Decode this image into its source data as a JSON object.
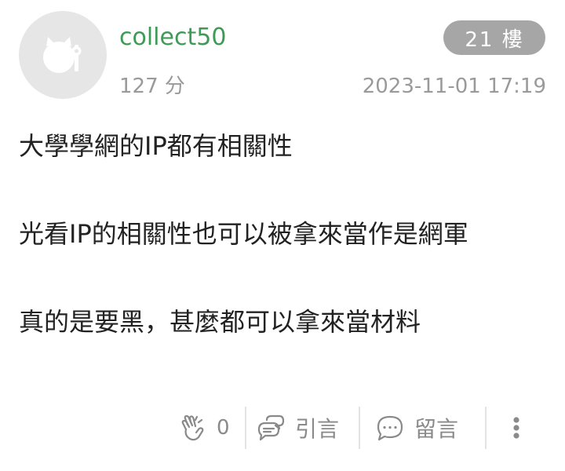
{
  "post": {
    "username": "collect50",
    "score": "127 分",
    "floor": "21 樓",
    "timestamp": "2023-11-01 17:19",
    "content": {
      "line1": "大學學網的IP都有相關性",
      "line2": "光看IP的相關性也可以被拿來當作是網軍",
      "line3": "真的是要黑，甚麼都可以拿來當材料"
    },
    "actions": {
      "like_count": "0",
      "quote_label": "引言",
      "comment_label": "留言"
    }
  },
  "colors": {
    "username": "#3f9a55",
    "badge_bg": "#a6a6a6",
    "muted_text": "#9a9a9a",
    "body_text": "#222222"
  },
  "icons": {
    "avatar": "default-avatar-icon",
    "like": "clap-icon",
    "quote": "quote-bubble-icon",
    "comment": "comment-bubble-icon",
    "more": "more-vertical-icon"
  }
}
